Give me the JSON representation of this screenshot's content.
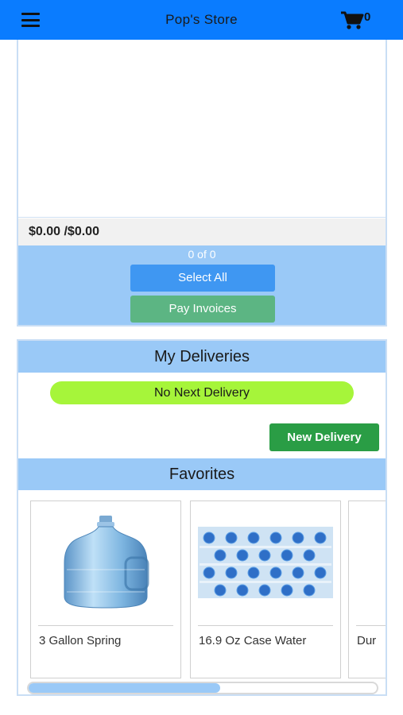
{
  "header": {
    "title": "Pop's Store",
    "cart_count": "0",
    "menu_icon": "hamburger-icon",
    "cart_icon": "shopping-cart-icon",
    "bar_color": "#0a7cff"
  },
  "invoices": {
    "total": "$0.00 /$0.00",
    "selected_count": "0 of 0",
    "select_all_label": "Select All",
    "pay_label": "Pay Invoices"
  },
  "deliveries": {
    "title": "My Deliveries",
    "next_delivery": "No Next Delivery",
    "new_delivery_label": "New Delivery"
  },
  "favorites": {
    "title": "Favorites",
    "items": [
      {
        "name": "3 Gallon Spring"
      },
      {
        "name": "16.9 Oz Case Water"
      },
      {
        "name": "Dur"
      }
    ],
    "scroll_fraction": 0.55
  },
  "colors": {
    "section_header": "#9ac9f7",
    "select_button": "#3f97f2",
    "pay_button": "#5cb583",
    "new_delivery_button": "#2a9d45",
    "next_delivery_pill": "#a6f53a"
  }
}
